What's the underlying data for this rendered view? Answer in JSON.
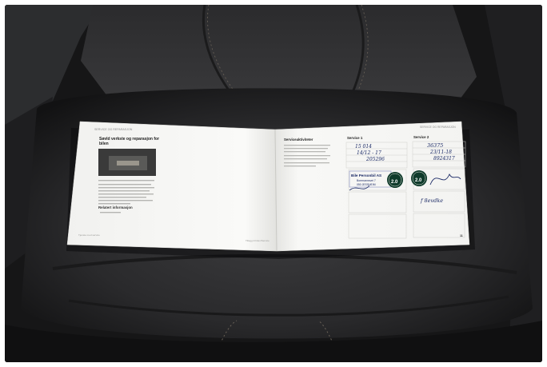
{
  "left_page": {
    "header": "SERVICE OG REPARASJON",
    "title_line1": "Søvld verkste og reparasjon for",
    "title_line2": "bilen",
    "section": "Relatert informasjon",
    "footer_left": "Tjenste med service",
    "footer_right": "Tillegg til bilen/Service"
  },
  "right_page": {
    "header": "SERVICE OG REPARASJON",
    "left_column_title": "Serviceaktiviteter",
    "service1": {
      "title": "Service 1",
      "km": "15 014",
      "date": "14/12 - 17",
      "order": "205296",
      "stamp_name": "Bile Personbil AS",
      "stamp_line2": "Borrmannsvei 7",
      "stamp_line3": "050 JESSHEIM",
      "badge": "2.0"
    },
    "service2": {
      "title": "Service 2",
      "km": "36375",
      "date": "23/11-18",
      "order": "8924317",
      "badge": "2.0",
      "signature": "f 8evdke"
    },
    "page_number": "11"
  }
}
